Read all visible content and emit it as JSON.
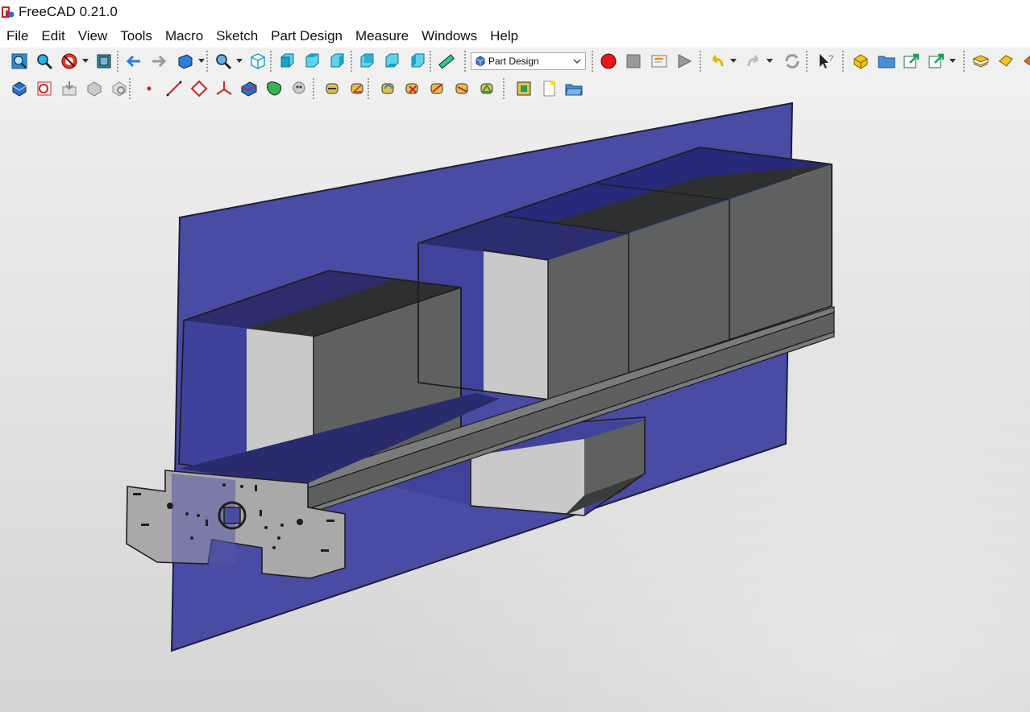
{
  "window": {
    "title": "FreeCAD 0.21.0"
  },
  "menu": {
    "items": [
      "File",
      "Edit",
      "View",
      "Tools",
      "Macro",
      "Sketch",
      "Part Design",
      "Measure",
      "Windows",
      "Help"
    ]
  },
  "toolbar": {
    "workbench_selector": "Part Design",
    "row1_icons": [
      "fit-all-icon",
      "fit-selection-icon",
      "draw-style-icon",
      "bounding-box-icon",
      "back-arrow-icon",
      "forward-arrow-icon",
      "sync-view-icon",
      "zoom-icon",
      "isometric-view-icon",
      "front-view-icon",
      "top-view-icon",
      "right-view-icon",
      "rear-view-icon",
      "bottom-view-icon",
      "left-view-icon",
      "measure-ruler-icon",
      "record-macro-icon",
      "stop-macro-icon",
      "edit-macro-icon",
      "execute-macro-icon",
      "undo-icon",
      "redo-icon",
      "refresh-icon",
      "whats-this-icon",
      "part-icon",
      "group-icon",
      "link-icon",
      "link-actions-icon",
      "std-part-icon",
      "body-icon",
      "part-extra-icon"
    ],
    "row2_icons": [
      "create-body-icon",
      "create-sketch-icon",
      "validate-sketch-icon",
      "shape-binder-icon",
      "clone-icon",
      "datum-point-icon",
      "datum-line-icon",
      "datum-plane-icon",
      "local-coordinate-icon",
      "subshape-binder-icon",
      "sub-shape-icon",
      "carbon-copy-icon",
      "measure-linear-icon",
      "measure-angular-icon",
      "measure-refresh-icon",
      "measure-clear-icon",
      "measure-toggle-all-icon",
      "measure-toggle-3d-icon",
      "measure-toggle-delta-icon",
      "measure-toggle-labels-icon",
      "new-document-icon",
      "open-document-icon",
      "save-document-icon"
    ]
  },
  "colors": {
    "plane": "#4a4ba3",
    "plane_edge": "#1e1e3a",
    "box_light": "#c8c8c8",
    "box_dark": "#5f6060",
    "box_top": "#2e2f30",
    "beam": "#6a6b6b",
    "background_top": "#eeeeee",
    "background_bottom": "#d5d5d5"
  }
}
